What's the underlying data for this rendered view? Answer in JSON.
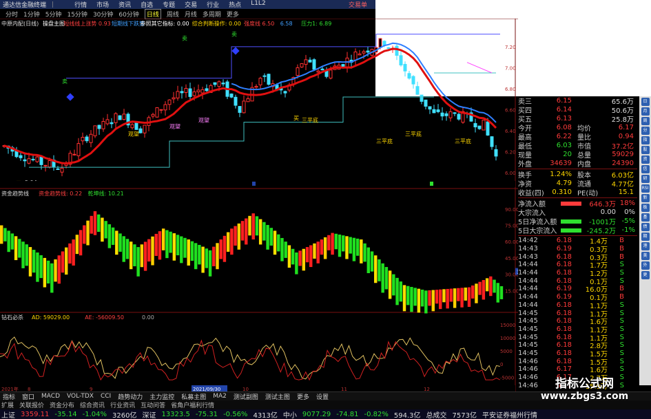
{
  "window": {
    "title": "通达信金融终端",
    "menus": [
      "行情",
      "市场",
      "资讯",
      "自选",
      "专题",
      "交易",
      "行业",
      "热点",
      "L1L2"
    ],
    "brand": "交易单"
  },
  "periods": [
    "分时",
    "1分钟",
    "5分钟",
    "15分钟",
    "30分钟",
    "60分钟",
    "日线",
    "周线",
    "月线",
    "多周期",
    "更多"
  ],
  "active_period": "日线",
  "main_indicator": {
    "name": "中原内配(日线)",
    "items": [
      {
        "label": "操盘主图",
        "color": "#ffffff"
      },
      {
        "label": "短线线上涨势 0.93",
        "color": "#ff4040"
      },
      {
        "label": "短期线下跌势",
        "color": "#40a0ff"
      },
      {
        "label": "参照其它指标: 0.00",
        "color": "#ffffff"
      },
      {
        "label": "综合判断操作: 0.00",
        "color": "#ffd700"
      },
      {
        "label": "强度线 6.50",
        "color": "#ff4040"
      },
      {
        "label": "6.58",
        "color": "#40a0ff"
      },
      {
        "label": "压力1: 6.89",
        "color": "#2fe02f"
      }
    ],
    "price_axis": [
      "7.20",
      "7.00",
      "6.80",
      "6.60",
      "6.40",
      "6.20",
      "6.00"
    ],
    "markers": {
      "sell1": "卖",
      "sell2": "卖",
      "sell3": "卖",
      "buy_point": "买",
      "bottom1": "三平底",
      "bottom2": "三平底",
      "bottom3": "三平底",
      "bottom4": "三平底",
      "low_price": "5.94",
      "hold1": "观望",
      "hold2": "观望",
      "hold3": "观望",
      "tag_b": "B",
      "tag_s": "S"
    }
  },
  "sub1": {
    "name": "资金趋势线",
    "items": [
      {
        "label": "资金趋势线: 0.22",
        "color": "#ff4040"
      },
      {
        "label": "乾坤线: 10.21",
        "color": "#2fe02f"
      }
    ],
    "axis": [
      "90.00",
      "75.00",
      "60.00",
      "45.00",
      "30.00",
      "15.00"
    ],
    "current": "32.53"
  },
  "sub2": {
    "name": "钻石必杀",
    "items": [
      {
        "label": "AD: 59029.00",
        "color": "#ffd700"
      },
      {
        "label": "AE: -56009.50",
        "color": "#ff4040"
      },
      {
        "label": "0.00",
        "color": "#aaaaaa"
      }
    ],
    "axis": [
      "15000",
      "10000",
      "5000",
      "0",
      "-5000"
    ]
  },
  "date_axis": {
    "start": "2021年",
    "highlight": "2021/09/30",
    "marks": [
      "8",
      "9",
      "10",
      "11",
      "12"
    ]
  },
  "quote": {
    "rows": [
      {
        "l": "卖三",
        "v": "6.15",
        "r": "65.6万",
        "vc": "red"
      },
      {
        "l": "买四",
        "v": "6.14",
        "r": "50.6万",
        "vc": "red"
      },
      {
        "l": "买五",
        "v": "6.13",
        "r": "25.8万",
        "vc": "red"
      },
      {
        "l": "今开",
        "v": "6.08",
        "r2l": "均价",
        "r2v": "6.17",
        "vc": "red"
      },
      {
        "l": "最高",
        "v": "6.22",
        "r2l": "量比",
        "r2v": "0.94",
        "vc": "red"
      },
      {
        "l": "最低",
        "v": "6.03",
        "r2l": "市值",
        "r2v": "37.2亿",
        "vc": "grn"
      },
      {
        "l": "现量",
        "v": "20",
        "r2l": "总量",
        "r2v": "59029",
        "vc": "grn"
      },
      {
        "l": "外盘",
        "v": "34639",
        "r2l": "内盘",
        "r2v": "24390",
        "vc": "red"
      }
    ],
    "rows2": [
      {
        "l": "换手",
        "v": "1.24%",
        "r2l": "股本",
        "r2v": "6.03亿"
      },
      {
        "l": "净资",
        "v": "4.79",
        "r2l": "流通",
        "r2v": "4.77亿"
      },
      {
        "l": "收益(四)",
        "v": "0.310",
        "r2l": "PE(动)",
        "r2v": "15.1"
      }
    ],
    "flows": [
      {
        "l": "净流入额",
        "v": "646.3万",
        "p": "18%",
        "c": "red"
      },
      {
        "l": "大宗流入",
        "v": "0.00",
        "p": "0%",
        "c": "wht"
      },
      {
        "l": "5日净流入额",
        "v": "-1001万",
        "p": "-5%",
        "c": "grn"
      },
      {
        "l": "5日大宗流入",
        "v": "-245.2万",
        "p": "-1%",
        "c": "grn"
      }
    ],
    "ticks": [
      [
        "14:42",
        "6.18",
        "1.4万",
        "B"
      ],
      [
        "14:43",
        "6.19",
        "0.3万",
        "B"
      ],
      [
        "14:43",
        "6.18",
        "0.3万",
        "B"
      ],
      [
        "14:44",
        "6.18",
        "1.7万",
        "S"
      ],
      [
        "14:44",
        "6.18",
        "1.2万",
        "S"
      ],
      [
        "14:44",
        "6.18",
        "0.1万",
        "S"
      ],
      [
        "14:44",
        "6.19",
        "16.0万",
        "B"
      ],
      [
        "14:44",
        "6.19",
        "0.1万",
        "B"
      ],
      [
        "14:44",
        "6.18",
        "1.1万",
        "S"
      ],
      [
        "14:45",
        "6.18",
        "1.1万",
        "S"
      ],
      [
        "14:45",
        "6.18",
        "1.6万",
        "S"
      ],
      [
        "14:45",
        "6.18",
        "1.1万",
        "S"
      ],
      [
        "14:45",
        "6.18",
        "1.1万",
        "S"
      ],
      [
        "14:45",
        "6.18",
        "2.8万",
        "S"
      ],
      [
        "14:45",
        "6.18",
        "1.5万",
        "S"
      ],
      [
        "14:46",
        "6.18",
        "1.5万",
        "S"
      ],
      [
        "14:46",
        "6.17",
        "1.6万",
        "S"
      ],
      [
        "14:46",
        "6.17",
        "2.7万",
        "S"
      ],
      [
        "14:46",
        "6.17",
        "15.9万",
        "S"
      ]
    ]
  },
  "tabs": [
    "指标",
    "窗口",
    "MACD",
    "VOL-TDX",
    "CCI",
    "趋势动力",
    "主力监控",
    "私募主图",
    "MA2",
    "测试副图",
    "测试主图",
    "更多",
    "设置"
  ],
  "tabs2": [
    "扩展",
    "关联报价",
    "资金分布",
    "综合资讯",
    "行业资讯",
    "互动问答",
    "省角户福利行情"
  ],
  "status": [
    {
      "t": "上证",
      "c": "wht"
    },
    {
      "t": "3359.11",
      "c": "red"
    },
    {
      "t": "-35.14",
      "c": "grn"
    },
    {
      "t": "-1.04%",
      "c": "grn"
    },
    {
      "t": "3260亿",
      "c": "wht"
    },
    {
      "t": "深证",
      "c": "wht"
    },
    {
      "t": "13323.5",
      "c": "grn"
    },
    {
      "t": "-75.31",
      "c": "grn"
    },
    {
      "t": "-0.56%",
      "c": "grn"
    },
    {
      "t": "4313亿",
      "c": "wht"
    },
    {
      "t": "中小",
      "c": "wht"
    },
    {
      "t": "9077.29",
      "c": "grn"
    },
    {
      "t": "-74.81",
      "c": "grn"
    },
    {
      "t": "-0.82%",
      "c": "grn"
    },
    {
      "t": "594.3亿",
      "c": "wht"
    },
    {
      "t": "总成交",
      "c": "wht"
    },
    {
      "t": "7573亿",
      "c": "wht"
    },
    {
      "t": "平安证券福州行情",
      "c": "wht"
    }
  ],
  "watermark": {
    "line1": "指标公式网",
    "line2": "www.zbgs3.com"
  },
  "icons": [
    "日",
    "月",
    "周",
    "分",
    "指",
    "股",
    "资",
    "信",
    "研",
    "RSI",
    "新",
    "板",
    "基",
    "债",
    "期",
    "港",
    "美",
    "外",
    "更"
  ]
}
